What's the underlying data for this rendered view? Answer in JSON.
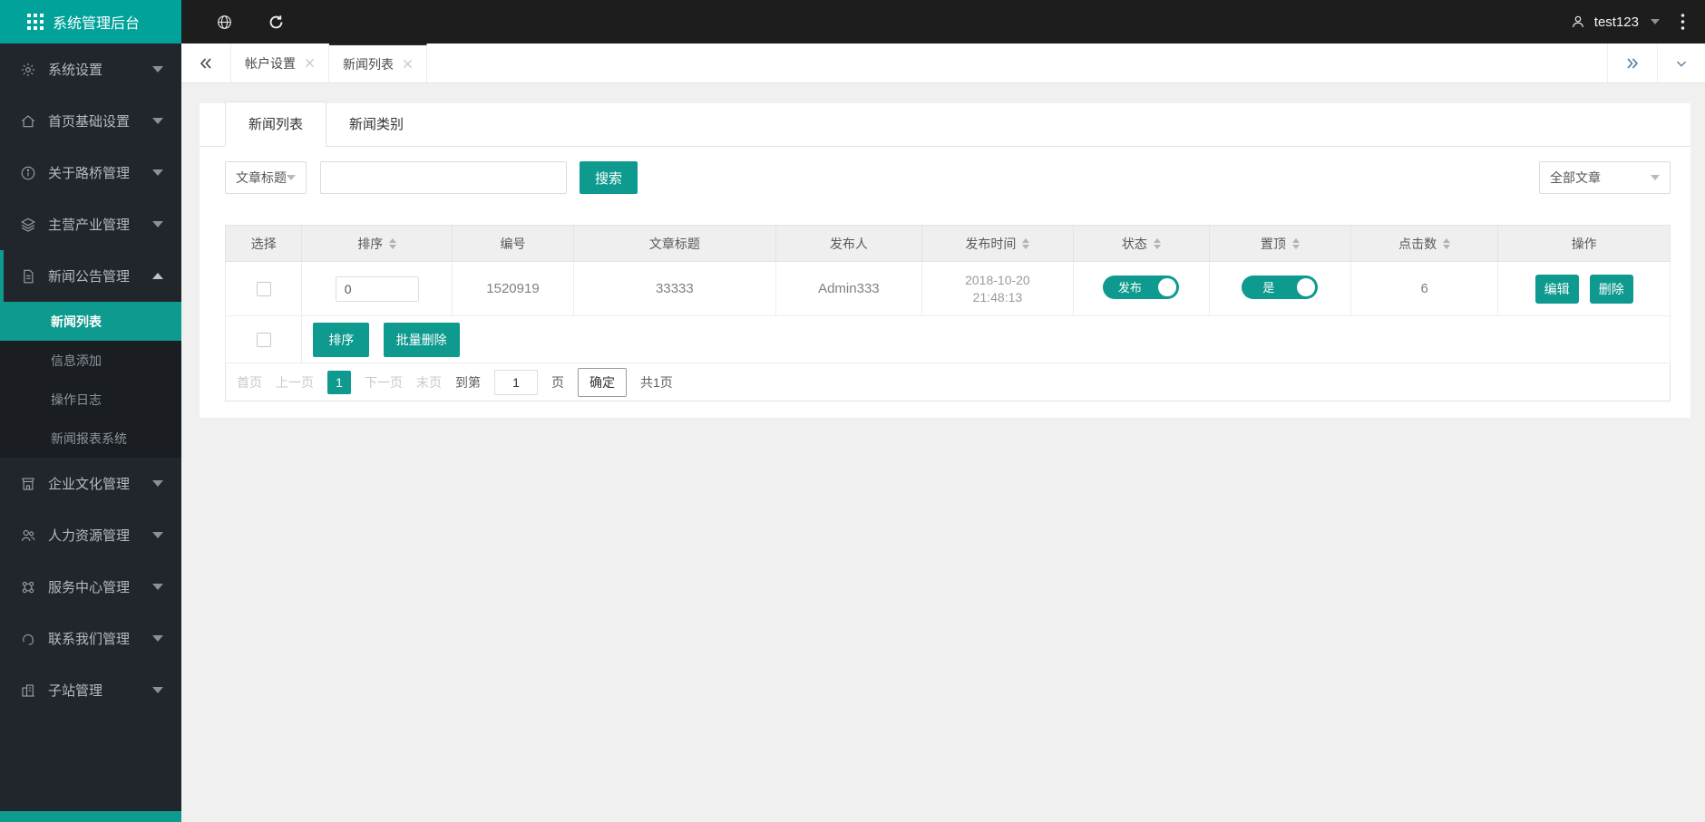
{
  "colors": {
    "accent": "#0e9a8e",
    "brand_bg": "#00a29a",
    "topbar_bg": "#1d1d1d",
    "sidebar_bg": "#21262c",
    "submenu_bg": "#1a1e23",
    "content_bg": "#f0f0f0"
  },
  "icons": {
    "brand": "grid-icon",
    "topbar": [
      "globe-icon",
      "refresh-icon",
      "person-icon",
      "caret-down-icon",
      "kebab-menu-icon"
    ],
    "sidebar": [
      "gear-icon",
      "home-icon",
      "info-circle-icon",
      "layers-icon",
      "document-icon",
      "storefront-icon",
      "users-icon",
      "command-icon",
      "headset-icon",
      "buildings-icon"
    ],
    "tabbar": [
      "double-chevron-left-icon",
      "close-icon",
      "double-chevron-right-icon",
      "chevron-down-icon"
    ],
    "table": [
      "sort-arrows-icon",
      "checkbox",
      "toggle-knob"
    ]
  },
  "topbar": {
    "brand": "系统管理后台",
    "user": "test123"
  },
  "sidebar": {
    "items": [
      {
        "label": "系统设置"
      },
      {
        "label": "首页基础设置"
      },
      {
        "label": "关于路桥管理"
      },
      {
        "label": "主营产业管理"
      },
      {
        "label": "新闻公告管理",
        "expanded": true,
        "children": [
          {
            "label": "新闻列表",
            "active": true
          },
          {
            "label": "信息添加"
          },
          {
            "label": "操作日志"
          },
          {
            "label": "新闻报表系统"
          }
        ]
      },
      {
        "label": "企业文化管理"
      },
      {
        "label": "人力资源管理"
      },
      {
        "label": "服务中心管理"
      },
      {
        "label": "联系我们管理"
      },
      {
        "label": "子站管理"
      }
    ]
  },
  "tabbar": {
    "tabs": [
      {
        "label": "帐户设置",
        "active": false
      },
      {
        "label": "新闻列表",
        "active": true
      }
    ]
  },
  "content": {
    "tabs": [
      {
        "label": "新闻列表",
        "active": true
      },
      {
        "label": "新闻类别",
        "active": false
      }
    ],
    "search": {
      "field_select": "文章标题",
      "input_value": "",
      "button": "搜索",
      "filter_select": "全部文章"
    },
    "table": {
      "headers": [
        {
          "label": "选择",
          "sortable": false
        },
        {
          "label": "排序",
          "sortable": true
        },
        {
          "label": "编号",
          "sortable": false
        },
        {
          "label": "文章标题",
          "sortable": false
        },
        {
          "label": "发布人",
          "sortable": false
        },
        {
          "label": "发布时间",
          "sortable": true
        },
        {
          "label": "状态",
          "sortable": true
        },
        {
          "label": "置顶",
          "sortable": true
        },
        {
          "label": "点击数",
          "sortable": true
        },
        {
          "label": "操作",
          "sortable": false
        }
      ],
      "row": {
        "sort_value": "0",
        "id": "1520919",
        "title": "33333",
        "publisher": "Admin333",
        "publish_date": "2018-10-20",
        "publish_time": "21:48:13",
        "status_label": "发布",
        "status_on": true,
        "top_label": "是",
        "top_on": true,
        "clicks": "6",
        "edit_label": "编辑",
        "delete_label": "删除"
      },
      "footer_buttons": {
        "sort": "排序",
        "batch_delete": "批量删除"
      }
    },
    "pagination": {
      "first": "首页",
      "prev": "上一页",
      "current": "1",
      "next": "下一页",
      "last": "末页",
      "goto_prefix": "到第",
      "goto_value": "1",
      "goto_suffix": "页",
      "confirm": "确定",
      "total": "共1页"
    }
  }
}
